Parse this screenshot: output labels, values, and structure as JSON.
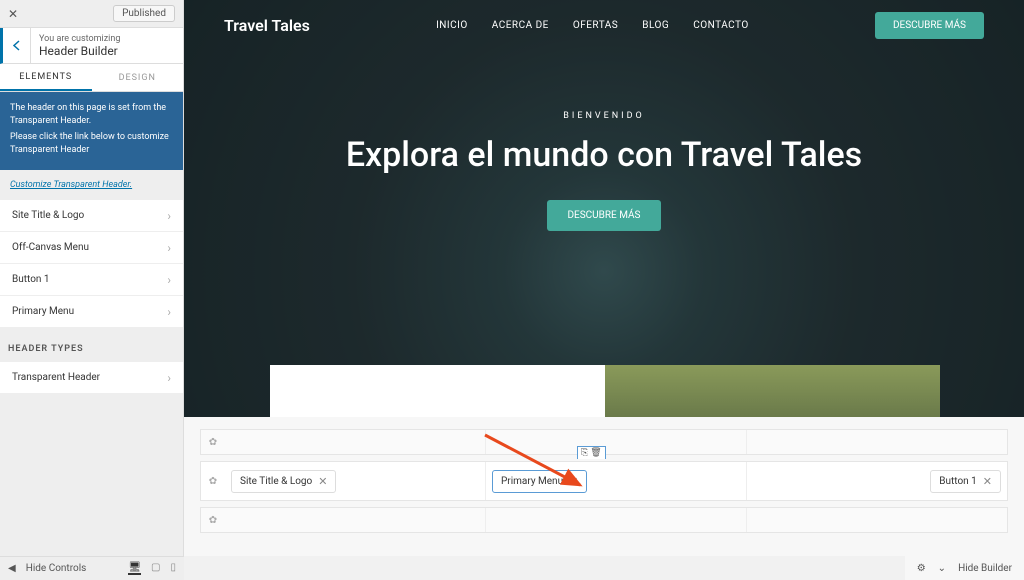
{
  "sidebar": {
    "published": "Published",
    "youare": "You are customizing",
    "title": "Header Builder",
    "tabs": {
      "elements": "ELEMENTS",
      "design": "DESIGN"
    },
    "notice_l1": "The header on this page is set from the Transparent Header.",
    "notice_l2": "Please click the link below to customize Transparent Header",
    "notice_link": "Customize Transparent Header.",
    "items": [
      "Site Title & Logo",
      "Off-Canvas Menu",
      "Button 1",
      "Primary Menu"
    ],
    "types_label": "HEADER TYPES",
    "types": [
      "Transparent Header"
    ]
  },
  "preview": {
    "brand": "Travel Tales",
    "menu": [
      "INICIO",
      "ACERCA DE",
      "OFERTAS",
      "BLOG",
      "CONTACTO"
    ],
    "cta": "DESCUBRE MÁS",
    "welcome": "BIENVENIDO",
    "headline": "Explora el mundo con Travel Tales",
    "hero_btn": "DESCUBRE MÁS"
  },
  "builder": {
    "chips": {
      "left": "Site Title & Logo",
      "center": "Primary Menu",
      "right": "Button 1"
    }
  },
  "footer": {
    "hide_controls": "Hide Controls",
    "hide_builder": "Hide Builder"
  }
}
